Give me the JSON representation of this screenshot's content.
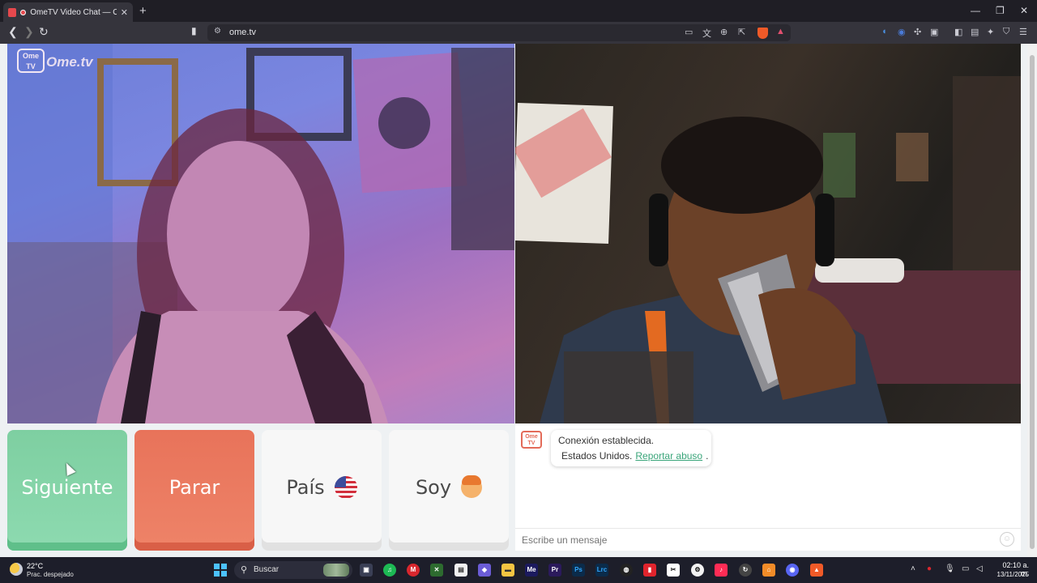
{
  "browser": {
    "tab_title": "OmeTV Video Chat — Omegl",
    "tab_close": "✕",
    "new_tab": "+",
    "url": "ome.tv",
    "controls": {
      "minimize": "—",
      "restore": "❐",
      "close": "✕"
    }
  },
  "video": {
    "logo_badge": "Ome\nTV",
    "logo_word": "Ome.tv"
  },
  "buttons": {
    "next": "Siguiente",
    "stop": "Parar",
    "country": "País",
    "gender": "Soy"
  },
  "chat": {
    "logo": "Ome TV",
    "status": "Conexión establecida.",
    "country": "Estados Unidos.",
    "report_link": "Reportar abuso",
    "report_suffix": ".",
    "input_placeholder": "Escribe un mensaje",
    "emoji": "☺"
  },
  "taskbar": {
    "temperature": "22°C",
    "weather": "Prac. despejado",
    "search": "Buscar",
    "time": "02:10 a. m.",
    "date": "13/11/2025",
    "apps": [
      {
        "name": "spotify",
        "glyph": "♫",
        "color": "#1db954"
      },
      {
        "name": "mega",
        "glyph": "M",
        "color": "#d9272e"
      },
      {
        "name": "media-encoder",
        "glyph": "Me",
        "color": "#1c1a5e"
      },
      {
        "name": "premiere",
        "glyph": "Pr",
        "color": "#2b1a5c"
      },
      {
        "name": "photoshop",
        "glyph": "Ps",
        "color": "#0b2b4a"
      },
      {
        "name": "lightroom-classic",
        "glyph": "Lrc",
        "color": "#0b2b4a"
      },
      {
        "name": "tiktok",
        "glyph": "♪",
        "color": "#ff2c55"
      },
      {
        "name": "discord",
        "glyph": "◉",
        "color": "#5865f2"
      },
      {
        "name": "brave",
        "glyph": "▲",
        "color": "#f05a28"
      }
    ]
  },
  "colors": {
    "next": "#7ecfa1",
    "stop": "#e8735a",
    "link": "#3aa57a",
    "brand": "#e36b59"
  }
}
